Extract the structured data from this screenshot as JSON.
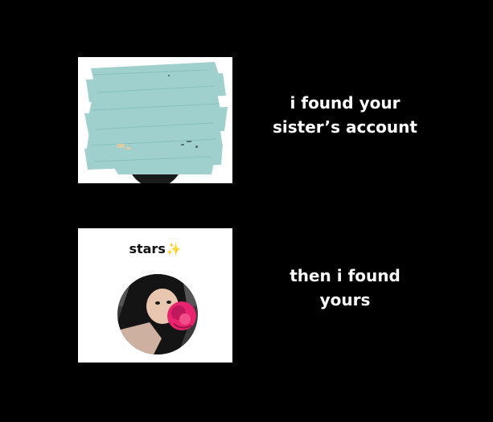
{
  "panels": {
    "top": {
      "caption_line1": "i found your",
      "caption_line2": "sister’s account",
      "scribble_color": "#9fd0cd"
    },
    "bottom": {
      "title": "stars",
      "title_icon": "sparkle-icon",
      "caption_line1": "then i found",
      "caption_line2": "yours",
      "accent_flower": "#e8246e"
    }
  }
}
